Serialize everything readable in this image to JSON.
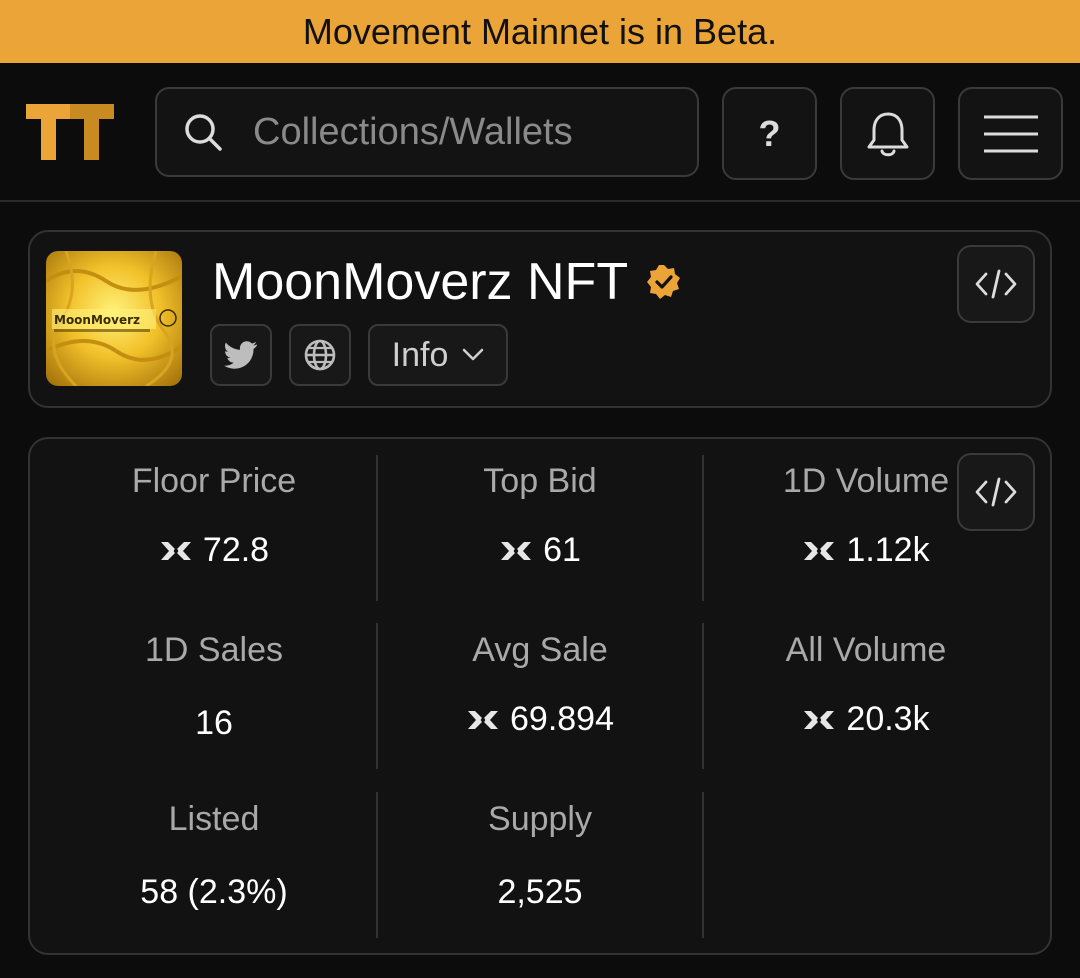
{
  "banner": {
    "text": "Movement Mainnet is in Beta."
  },
  "header": {
    "search_placeholder": "Collections/Wallets",
    "help_label": "?"
  },
  "collection": {
    "name": "MoonMoverz NFT",
    "thumb_text": "MoonMoverz",
    "info_label": "Info"
  },
  "stats": {
    "floor_price": {
      "label": "Floor Price",
      "value": "72.8"
    },
    "top_bid": {
      "label": "Top Bid",
      "value": "61"
    },
    "volume_1d": {
      "label": "1D Volume",
      "value": "1.12k"
    },
    "sales_1d": {
      "label": "1D Sales",
      "value": "16"
    },
    "avg_sale": {
      "label": "Avg Sale",
      "value": "69.894"
    },
    "all_volume": {
      "label": "All Volume",
      "value": "20.3k"
    },
    "listed": {
      "label": "Listed",
      "value": "58 (2.3%)"
    },
    "supply": {
      "label": "Supply",
      "value": "2,525"
    }
  },
  "colors": {
    "banner": "#eba438",
    "accent": "#eba438",
    "background": "#0c0c0c"
  },
  "icons": [
    "logo-icon",
    "search-icon",
    "bell-icon",
    "menu-icon",
    "verified-icon",
    "twitter-icon",
    "globe-icon",
    "chevron-down-icon",
    "code-icon",
    "move-token-icon"
  ]
}
